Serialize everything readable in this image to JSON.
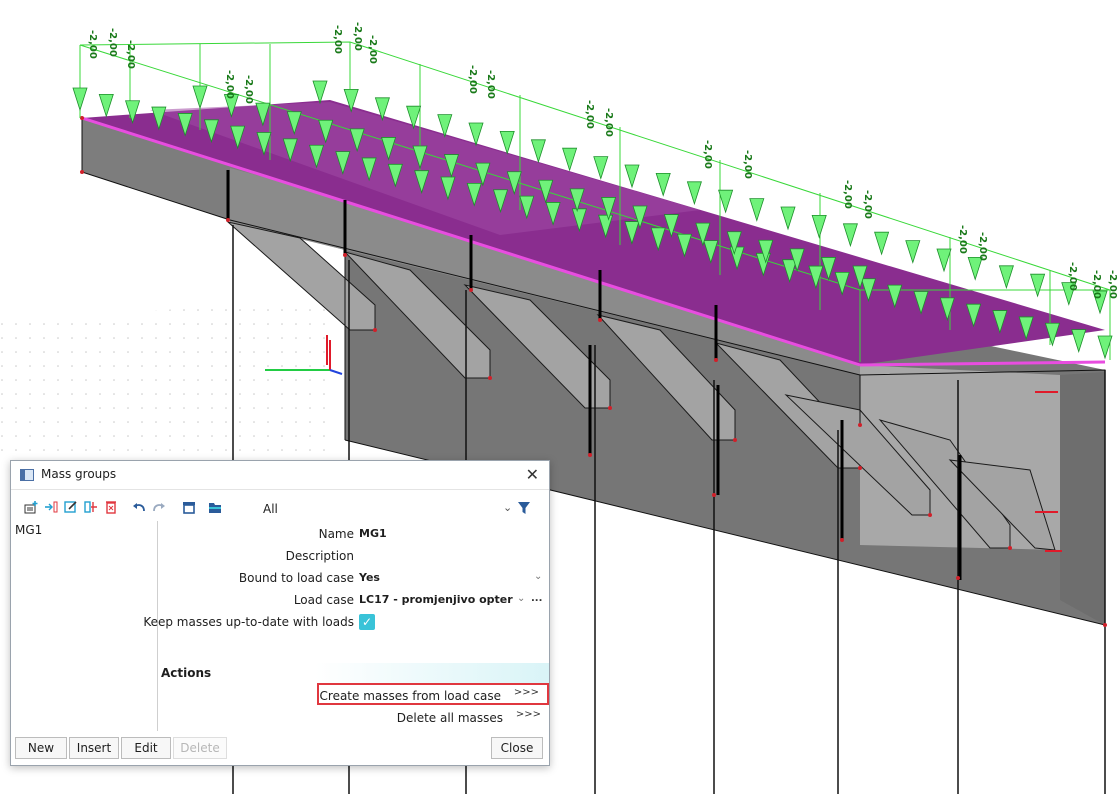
{
  "load_label": "-2,00",
  "dialog": {
    "title": "Mass groups",
    "filter": "All",
    "list_items": [
      "MG1"
    ],
    "properties": {
      "name_label": "Name",
      "name_value": "MG1",
      "description_label": "Description",
      "description_value": "",
      "bound_label": "Bound to load case",
      "bound_value": "Yes",
      "loadcase_label": "Load case",
      "loadcase_value": "LC17 - promjenjivo opter",
      "loadcase_more": "...",
      "keep_label": "Keep masses up-to-date with loads",
      "keep_checked": true
    },
    "actions_heading": "Actions",
    "actions": {
      "create_label": "Create masses from load case",
      "delete_label": "Delete all masses",
      "arrows": ">>>"
    },
    "buttons": {
      "new": "New",
      "insert": "Insert",
      "edit": "Edit",
      "delete": "Delete",
      "close": "Close"
    },
    "colors": {
      "accent": "#39c3d8",
      "highlight": "#e0373f"
    }
  }
}
